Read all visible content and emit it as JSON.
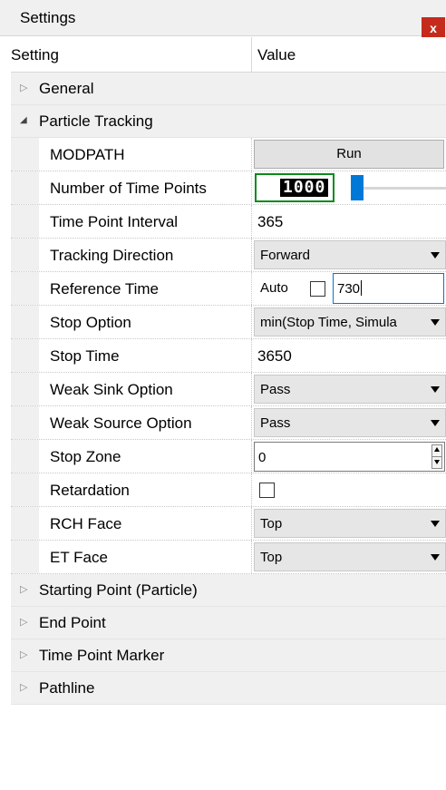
{
  "window": {
    "title": "Settings",
    "close_glyph": "x"
  },
  "header": {
    "setting": "Setting",
    "value": "Value"
  },
  "categories": {
    "general": "General",
    "particle_tracking": "Particle Tracking",
    "starting_point": "Starting Point (Particle)",
    "end_point": "End Point",
    "time_point_marker": "Time Point Marker",
    "pathline": "Pathline"
  },
  "rows": {
    "modpath": {
      "label": "MODPATH",
      "button": "Run"
    },
    "num_time_points": {
      "label": "Number of Time Points",
      "value": "1000",
      "slider_fraction": 0.0
    },
    "time_point_interval": {
      "label": "Time Point Interval",
      "value": "365"
    },
    "tracking_direction": {
      "label": "Tracking Direction",
      "value": "Forward"
    },
    "reference_time": {
      "label": "Reference Time",
      "auto_label": "Auto",
      "auto_checked": false,
      "value": "730"
    },
    "stop_option": {
      "label": "Stop Option",
      "value": "min(Stop Time, Simula"
    },
    "stop_time": {
      "label": "Stop Time",
      "value": "3650"
    },
    "weak_sink": {
      "label": "Weak Sink Option",
      "value": "Pass"
    },
    "weak_source": {
      "label": "Weak Source Option",
      "value": "Pass"
    },
    "stop_zone": {
      "label": "Stop Zone",
      "value": "0"
    },
    "retardation": {
      "label": "Retardation",
      "checked": false
    },
    "rch_face": {
      "label": "RCH Face",
      "value": "Top"
    },
    "et_face": {
      "label": "ET Face",
      "value": "Top"
    }
  },
  "icons": {
    "collapsed": "triangle-right-icon",
    "expanded": "triangle-down-icon",
    "close": "close-icon"
  },
  "colors": {
    "close_bg": "#c42b1c",
    "focus_border": "#0078d7",
    "lcd_border": "#0c8a1a",
    "slider_thumb": "#0078d7"
  }
}
